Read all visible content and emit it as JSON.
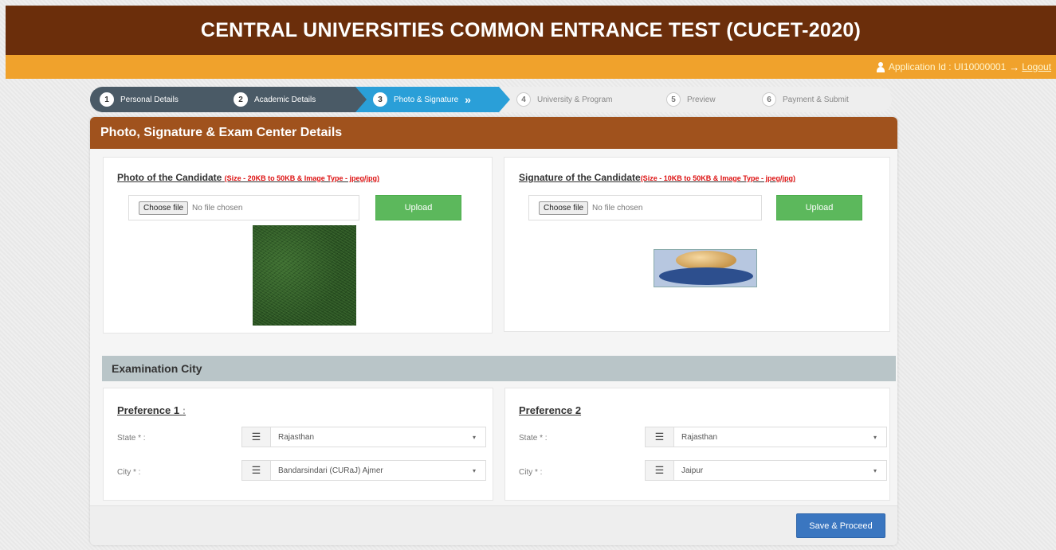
{
  "header": {
    "title": "CENTRAL UNIVERSITIES COMMON ENTRANCE TEST (CUCET-2020)"
  },
  "userbar": {
    "application_id": "Application Id : UI10000001",
    "logout_label": "Logout",
    "bar_color": "#f0a22c"
  },
  "steps": [
    {
      "num": "1",
      "label": "Personal Details",
      "state": "done"
    },
    {
      "num": "2",
      "label": "Academic Details",
      "state": "done"
    },
    {
      "num": "3",
      "label": "Photo & Signature",
      "state": "active"
    },
    {
      "num": "4",
      "label": "University & Program",
      "state": "todo"
    },
    {
      "num": "5",
      "label": "Preview",
      "state": "todo"
    },
    {
      "num": "6",
      "label": "Payment & Submit",
      "state": "todo"
    }
  ],
  "card": {
    "title": "Photo, Signature & Exam Center Details"
  },
  "photo": {
    "title": "Photo of the Candidate",
    "requirement": "(Size - 20KB to 50KB & Image Type - jpeg/jpg)",
    "choose_label": "Choose file",
    "file_status": "No file chosen",
    "upload_label": "Upload"
  },
  "signature": {
    "title": "Signature of the Candidate",
    "requirement": "(Size - 10KB to 50KB & Image Type - jpeg/jpg)",
    "choose_label": "Choose file",
    "file_status": "No file chosen",
    "upload_label": "Upload"
  },
  "exam_city": {
    "title": "Examination City",
    "preferences": [
      {
        "title": "Preference 1",
        "colon": ":",
        "state_label": "State * :",
        "state_value": "Rajasthan",
        "city_label": "City * :",
        "city_value": "Bandarsindari (CURaJ) Ajmer"
      },
      {
        "title": "Preference 2",
        "state_label": "State * :",
        "state_value": "Rajasthan",
        "city_label": "City * :",
        "city_value": "Jaipur"
      }
    ]
  },
  "actions": {
    "save_label": "Save & Proceed"
  },
  "colors": {
    "header": "#6b2e0b",
    "card_header": "#a0521d",
    "active_step": "#2a9fd8",
    "upload_button": "#5cb85c",
    "save_button": "#3a76c0"
  }
}
